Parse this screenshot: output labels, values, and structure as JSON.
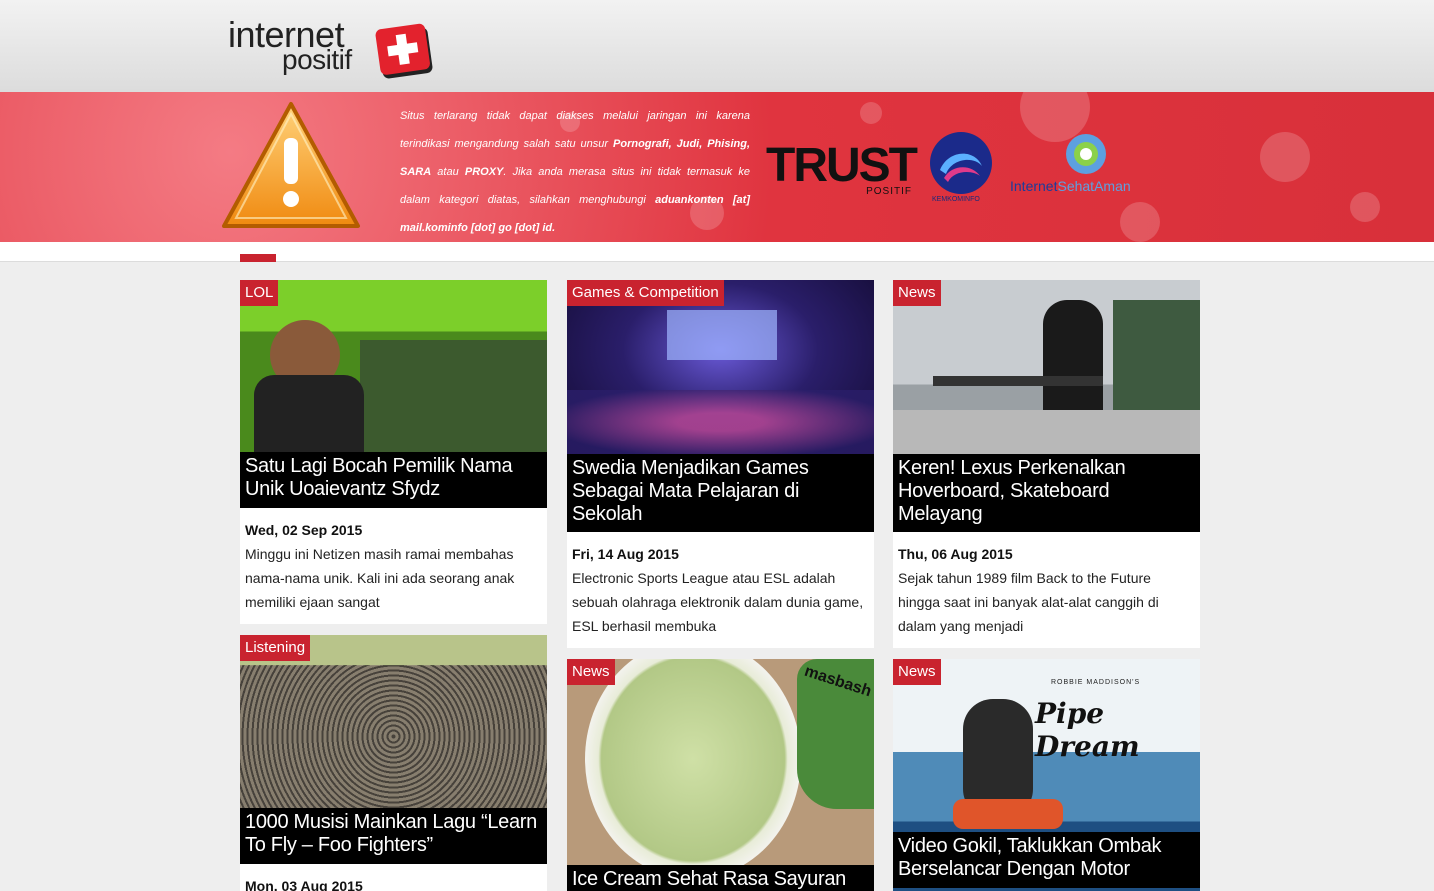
{
  "header": {
    "logo_line1": "internet",
    "logo_line2": "positif"
  },
  "banner": {
    "text_parts": [
      "Situs terlarang tidak dapat diakses melalui jaringan ini karena terindikasi mengandung salah satu unsur ",
      "Pornografi, Judi, Phising, SARA",
      " atau ",
      "PROXY",
      ". Jika anda merasa situs ini tidak termasuk ke dalam kategori diatas, silahkan menghubungi ",
      "aduankonten [at] mail.kominfo [dot] go [dot] id."
    ],
    "trust_text": "TRUST",
    "trust_sub": "POSITIF",
    "kominfo_label": "KEMKOMINFO",
    "isa_part1": "Internet",
    "isa_part2": "SehatAman"
  },
  "colors": {
    "accent": "#c9232f",
    "banner": "#d8303a"
  },
  "cards": [
    {
      "category": "LOL",
      "title": "Satu Lagi Bocah Pemilik Nama Unik Uoaievantz Sfydz",
      "date": "Wed, 02 Sep 2015",
      "excerpt": "Minggu ini Netizen masih ramai membahas nama-nama unik. Kali ini ada seorang anak memiliki ejaan sangat"
    },
    {
      "category": "Games & Competition",
      "title": "Swedia Menjadikan Games Sebagai Mata Pelajaran di Sekolah",
      "date": "Fri, 14 Aug 2015",
      "excerpt": "Electronic Sports League atau ESL adalah sebuah olahraga elektronik dalam dunia game, ESL berhasil membuka"
    },
    {
      "category": "News",
      "title": "Keren! Lexus Perkenalkan Hoverboard, Skateboard Melayang",
      "date": "Thu, 06 Aug 2015",
      "excerpt": "Sejak tahun 1989 film Back to the Future hingga saat ini banyak alat-alat canggih di dalam yang menjadi"
    },
    {
      "category": "Listening",
      "title": "1000 Musisi Mainkan Lagu “Learn To Fly – Foo Fighters”",
      "date": "Mon, 03 Aug 2015",
      "excerpt": ""
    },
    {
      "category": "News",
      "title": "Ice Cream Sehat Rasa Sayuran",
      "date": "",
      "excerpt": "",
      "image_text": "masbash"
    },
    {
      "category": "News",
      "title": "Video Gokil, Taklukkan Ombak Berselancar Dengan Motor",
      "date": "",
      "excerpt": "",
      "image_text_top": "ROBBIE MADDISON'S",
      "image_text_main": "Pipe Dream"
    }
  ]
}
